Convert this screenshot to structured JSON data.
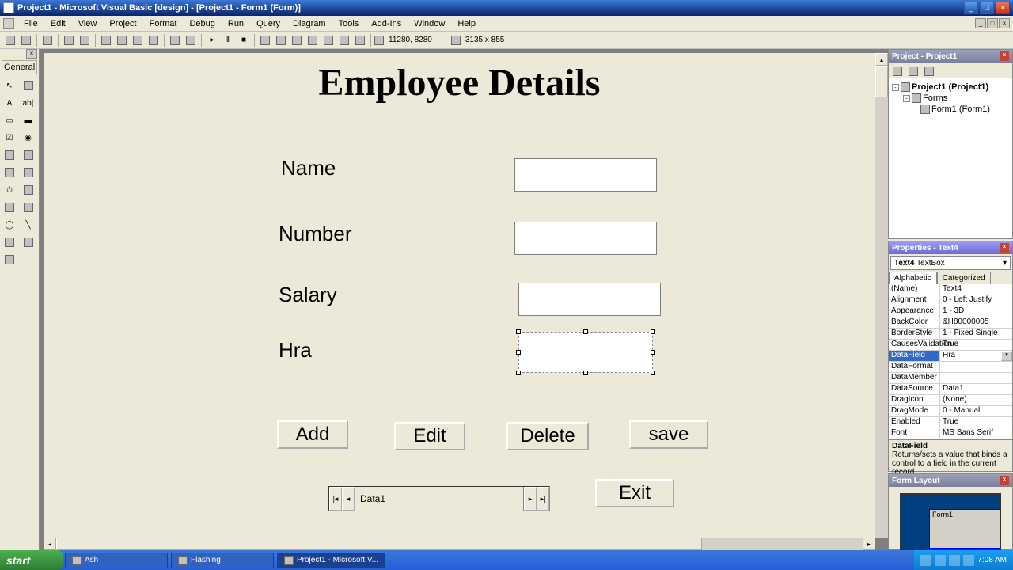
{
  "titlebar": {
    "text": "Project1 - Microsoft Visual Basic [design] - [Project1 - Form1 (Form)]"
  },
  "menu": {
    "items": [
      "File",
      "Edit",
      "View",
      "Project",
      "Format",
      "Debug",
      "Run",
      "Query",
      "Diagram",
      "Tools",
      "Add-Ins",
      "Window",
      "Help"
    ]
  },
  "toolbar": {
    "coords1": "11280, 8280",
    "coords2": "3135 x 855"
  },
  "toolbox": {
    "header": "General"
  },
  "form": {
    "title": "Employee Details",
    "labels": {
      "name": "Name",
      "number": "Number",
      "salary": "Salary",
      "hra": "Hra"
    },
    "buttons": {
      "add": "Add",
      "edit": "Edit",
      "delete": "Delete",
      "save": "save",
      "exit": "Exit"
    },
    "data_caption": "Data1"
  },
  "project_panel": {
    "title": "Project - Project1",
    "root": "Project1 (Project1)",
    "folder": "Forms",
    "item": "Form1 (Form1)"
  },
  "properties_panel": {
    "title": "Properties - Text4",
    "object_name": "Text4",
    "object_type": "TextBox",
    "tabs": {
      "alphabetic": "Alphabetic",
      "categorized": "Categorized"
    },
    "rows": [
      {
        "name": "(Name)",
        "value": "Text4"
      },
      {
        "name": "Alignment",
        "value": "0 - Left Justify"
      },
      {
        "name": "Appearance",
        "value": "1 - 3D"
      },
      {
        "name": "BackColor",
        "value": "&H80000005"
      },
      {
        "name": "BorderStyle",
        "value": "1 - Fixed Single"
      },
      {
        "name": "CausesValidation",
        "value": "True"
      },
      {
        "name": "DataField",
        "value": "Hra",
        "selected": true
      },
      {
        "name": "DataFormat",
        "value": ""
      },
      {
        "name": "DataMember",
        "value": ""
      },
      {
        "name": "DataSource",
        "value": "Data1"
      },
      {
        "name": "DragIcon",
        "value": "(None)"
      },
      {
        "name": "DragMode",
        "value": "0 - Manual"
      },
      {
        "name": "Enabled",
        "value": "True"
      },
      {
        "name": "Font",
        "value": "MS Sans Serif"
      }
    ],
    "desc_name": "DataField",
    "desc_text": "Returns/sets a value that binds a control to a field in the current record."
  },
  "layout_panel": {
    "title": "Form Layout",
    "form_name": "Form1"
  },
  "taskbar": {
    "start": "start",
    "items": [
      {
        "label": "Ash"
      },
      {
        "label": "Flashing"
      },
      {
        "label": "Project1 - Microsoft V...",
        "active": true
      }
    ],
    "time": "7:08 AM"
  }
}
